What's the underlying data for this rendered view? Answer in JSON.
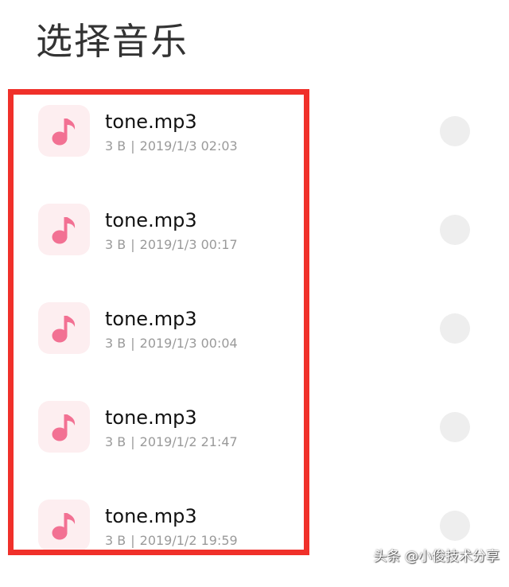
{
  "header": {
    "title": "选择音乐"
  },
  "files": [
    {
      "name": "tone.mp3",
      "size": "3 B",
      "separator": "|",
      "date": "2019/1/3 02:03",
      "selected": false
    },
    {
      "name": "tone.mp3",
      "size": "3 B",
      "separator": "|",
      "date": "2019/1/3 00:17",
      "selected": false
    },
    {
      "name": "tone.mp3",
      "size": "3 B",
      "separator": "|",
      "date": "2019/1/3 00:04",
      "selected": false
    },
    {
      "name": "tone.mp3",
      "size": "3 B",
      "separator": "|",
      "date": "2019/1/2 21:47",
      "selected": false
    },
    {
      "name": "tone.mp3",
      "size": "3 B",
      "separator": "|",
      "date": "2019/1/2 19:59",
      "selected": false
    }
  ],
  "icons": {
    "file": "music-note-icon",
    "select": "radio-button"
  },
  "colors": {
    "accent": "#f27193",
    "icon_bg": "#fdeef0",
    "highlight": "#f0302a"
  },
  "watermark": "头条 @小俊技术分享"
}
